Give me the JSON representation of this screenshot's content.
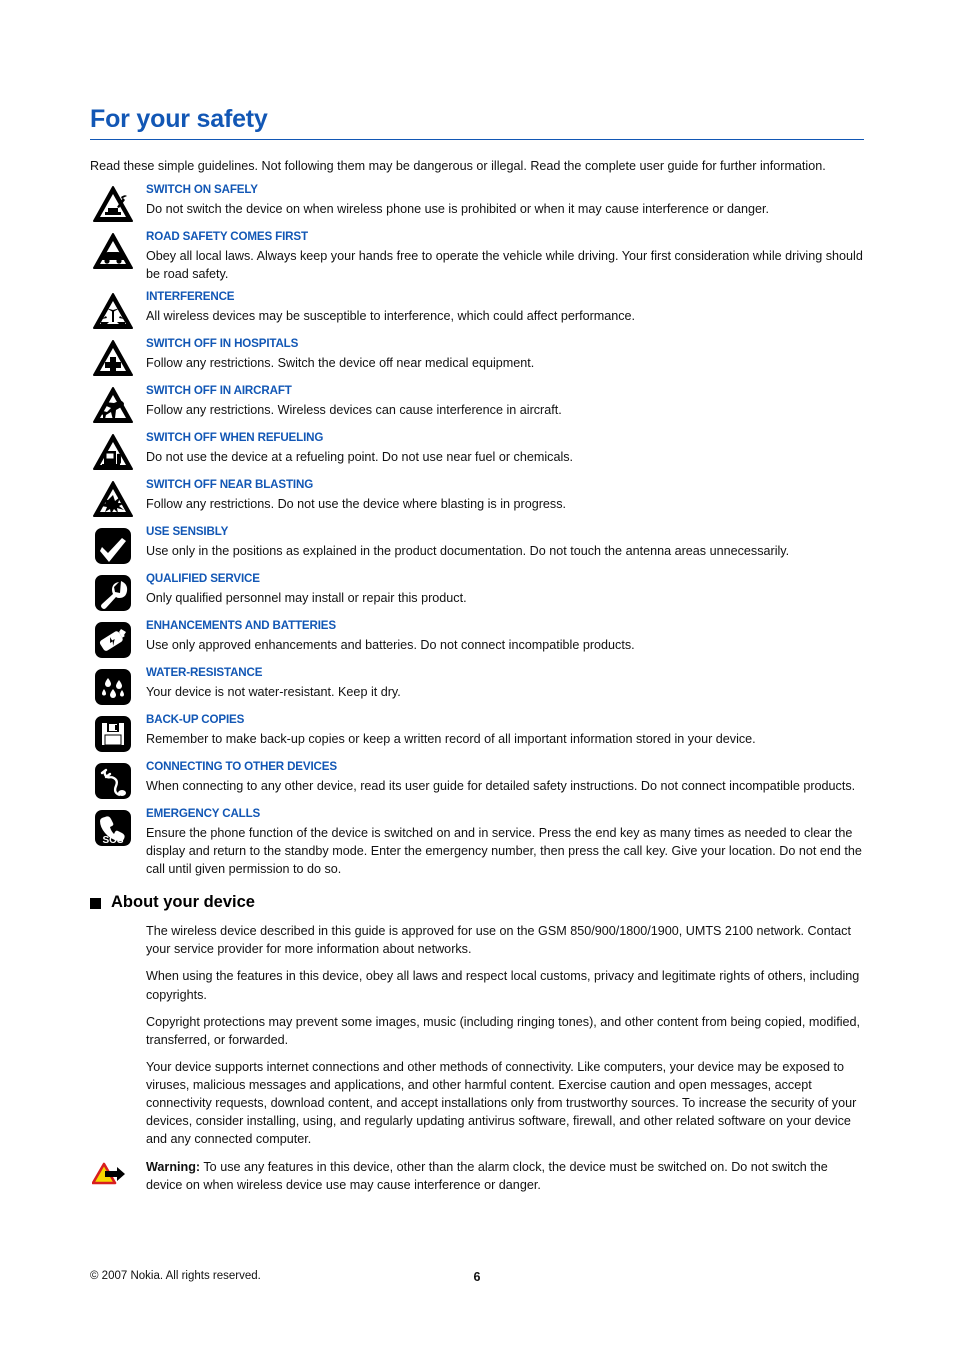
{
  "document": {
    "title": "For your safety",
    "intro": "Read these simple guidelines. Not following them may be dangerous or illegal. Read the complete user guide for further information.",
    "accent_color": "#1257b5",
    "body_color": "#111111"
  },
  "safety_items": [
    {
      "icon": "triangle-switch-on-icon",
      "heading": "SWITCH ON SAFELY",
      "body": "Do not switch the device on when wireless phone use is prohibited or when it may cause interference or danger."
    },
    {
      "icon": "triangle-car-icon",
      "heading": "ROAD SAFETY COMES FIRST",
      "body": "Obey all local laws. Always keep your hands free to operate the vehicle while driving. Your first consideration while driving should be road safety."
    },
    {
      "icon": "triangle-interference-icon",
      "heading": "INTERFERENCE",
      "body": "All wireless devices may be susceptible to interference, which could affect performance."
    },
    {
      "icon": "triangle-hospital-cross-icon",
      "heading": "SWITCH OFF IN HOSPITALS",
      "body": "Follow any restrictions. Switch the device off near medical equipment."
    },
    {
      "icon": "triangle-aircraft-icon",
      "heading": "SWITCH OFF IN AIRCRAFT",
      "body": "Follow any restrictions. Wireless devices can cause interference in aircraft."
    },
    {
      "icon": "triangle-fuel-pump-icon",
      "heading": "SWITCH OFF WHEN REFUELING",
      "body": "Do not use the device at a refueling point. Do not use near fuel or chemicals."
    },
    {
      "icon": "triangle-blasting-icon",
      "heading": "SWITCH OFF NEAR BLASTING",
      "body": "Follow any restrictions. Do not use the device where blasting is in progress."
    },
    {
      "icon": "square-checkmark-icon",
      "heading": "USE SENSIBLY",
      "body": "Use only in the positions as explained in the product documentation. Do not touch the antenna areas unnecessarily."
    },
    {
      "icon": "square-wrench-icon",
      "heading": "QUALIFIED SERVICE",
      "body": "Only qualified personnel may install or repair this product."
    },
    {
      "icon": "square-battery-icon",
      "heading": "ENHANCEMENTS AND BATTERIES",
      "body": "Use only approved enhancements and batteries. Do not connect incompatible products."
    },
    {
      "icon": "square-water-drops-icon",
      "heading": "WATER-RESISTANCE",
      "body": "Your device is not water-resistant. Keep it dry."
    },
    {
      "icon": "square-floppy-disk-icon",
      "heading": "BACK-UP COPIES",
      "body": "Remember to make back-up copies or keep a written record of all important information stored in your device."
    },
    {
      "icon": "square-cable-plug-icon",
      "heading": "CONNECTING TO OTHER DEVICES",
      "body": "When connecting to any other device, read its user guide for detailed safety instructions. Do not connect incompatible products."
    },
    {
      "icon": "square-sos-phone-icon",
      "heading": "EMERGENCY CALLS",
      "body": "Ensure the phone function of the device is switched on and in service. Press the end key as many times as needed to clear the display and return to the standby mode. Enter the emergency number, then press the call key. Give your location. Do not end the call until given permission to do so."
    }
  ],
  "about_section": {
    "heading": "About your device",
    "paragraphs": [
      "The wireless device described in this guide is approved for use on the GSM 850/900/1800/1900, UMTS 2100 network. Contact your service provider for more information about networks.",
      "When using the features in this device, obey all laws and respect local customs, privacy and legitimate rights of others, including copyrights.",
      "Copyright protections may prevent some images, music (including ringing tones), and other content from being copied, modified, transferred, or forwarded.",
      "Your device supports internet connections and other methods of connectivity. Like computers, your device may be exposed to viruses, malicious messages and applications, and other harmful content. Exercise caution and open messages, accept connectivity requests, download content, and accept installations only from trustworthy sources. To increase the security of your devices, consider installing, using, and regularly updating antivirus software, firewall, and other related software on your device and any connected computer."
    ]
  },
  "warning": {
    "icon": "warning-triangle-arrow-icon",
    "label": "Warning:",
    "text": "To use any features in this device, other than the alarm clock, the device must be switched on. Do not switch the device on when wireless device use may cause interference or danger.",
    "triangle_fill": "#f5d800",
    "triangle_stroke": "#d81e1e"
  },
  "footer": {
    "copyright": "© 2007 Nokia. All rights reserved.",
    "page_number": "6"
  }
}
